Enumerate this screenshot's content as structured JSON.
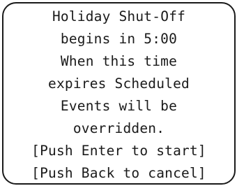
{
  "display": {
    "message_lines": [
      "Holiday Shut-Off",
      "begins in 5:00",
      "When this time",
      "expires Scheduled",
      "Events will be",
      "overridden."
    ],
    "prompt_start": "[Push Enter to start]",
    "prompt_cancel": "[Push Back to cancel]"
  }
}
